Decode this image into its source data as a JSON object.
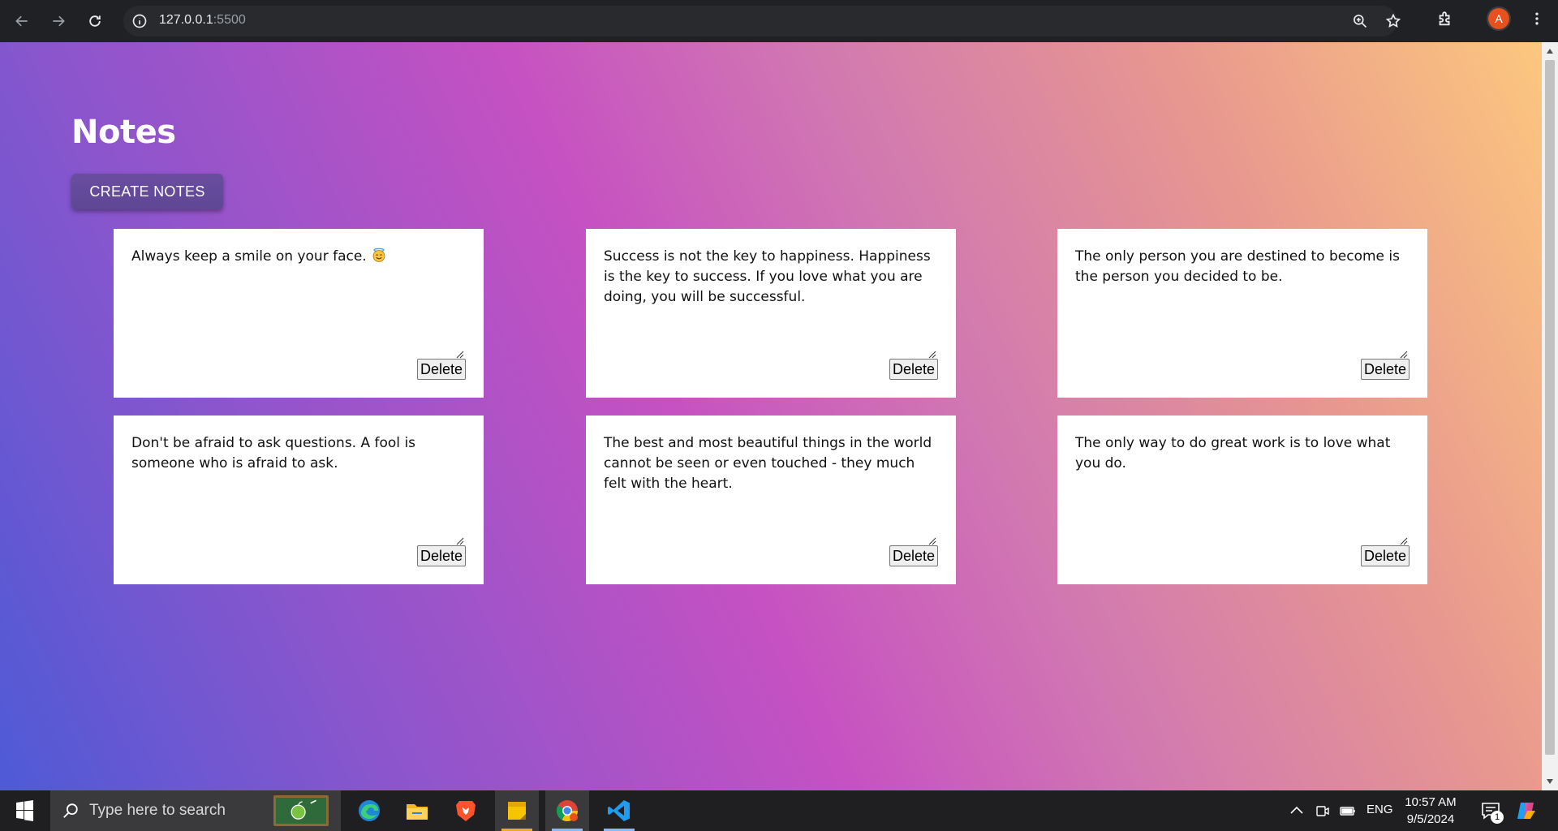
{
  "browser": {
    "url_host": "127.0.0.1",
    "url_port": ":5500",
    "profile_initial": "A"
  },
  "page": {
    "title": "Notes",
    "create_button_label": "CREATE NOTES",
    "delete_label": "Delete"
  },
  "notes": [
    {
      "text": "Always keep a smile on your face.",
      "emoji": "smiling-face-with-halo"
    },
    {
      "text": "Success is not the key to happiness. Happiness is the key to success. If you love what you are doing, you will be successful."
    },
    {
      "text": "The only person you are destined to become is the person you decided to be."
    },
    {
      "text": "Don't be afraid to ask questions. A fool is someone who is afraid to ask."
    },
    {
      "text": "The best and most beautiful things in the world cannot be seen or even touched - they much felt with the heart."
    },
    {
      "text": "The only way to do great work is to love what you do."
    }
  ],
  "taskbar": {
    "search_placeholder": "Type here to search",
    "language": "ENG",
    "time": "10:57 AM",
    "date": "9/5/2024",
    "notification_count": "1",
    "apps": [
      "edge-icon",
      "file-explorer-icon",
      "brave-icon",
      "sticky-notes-icon",
      "chrome-icon",
      "vscode-icon"
    ]
  },
  "colors": {
    "gradient": [
      "#4e5ad6",
      "#8e55cc",
      "#c651c2",
      "#d27ab0",
      "#e8978f",
      "#fcc77e"
    ],
    "button": "#5f4795"
  }
}
